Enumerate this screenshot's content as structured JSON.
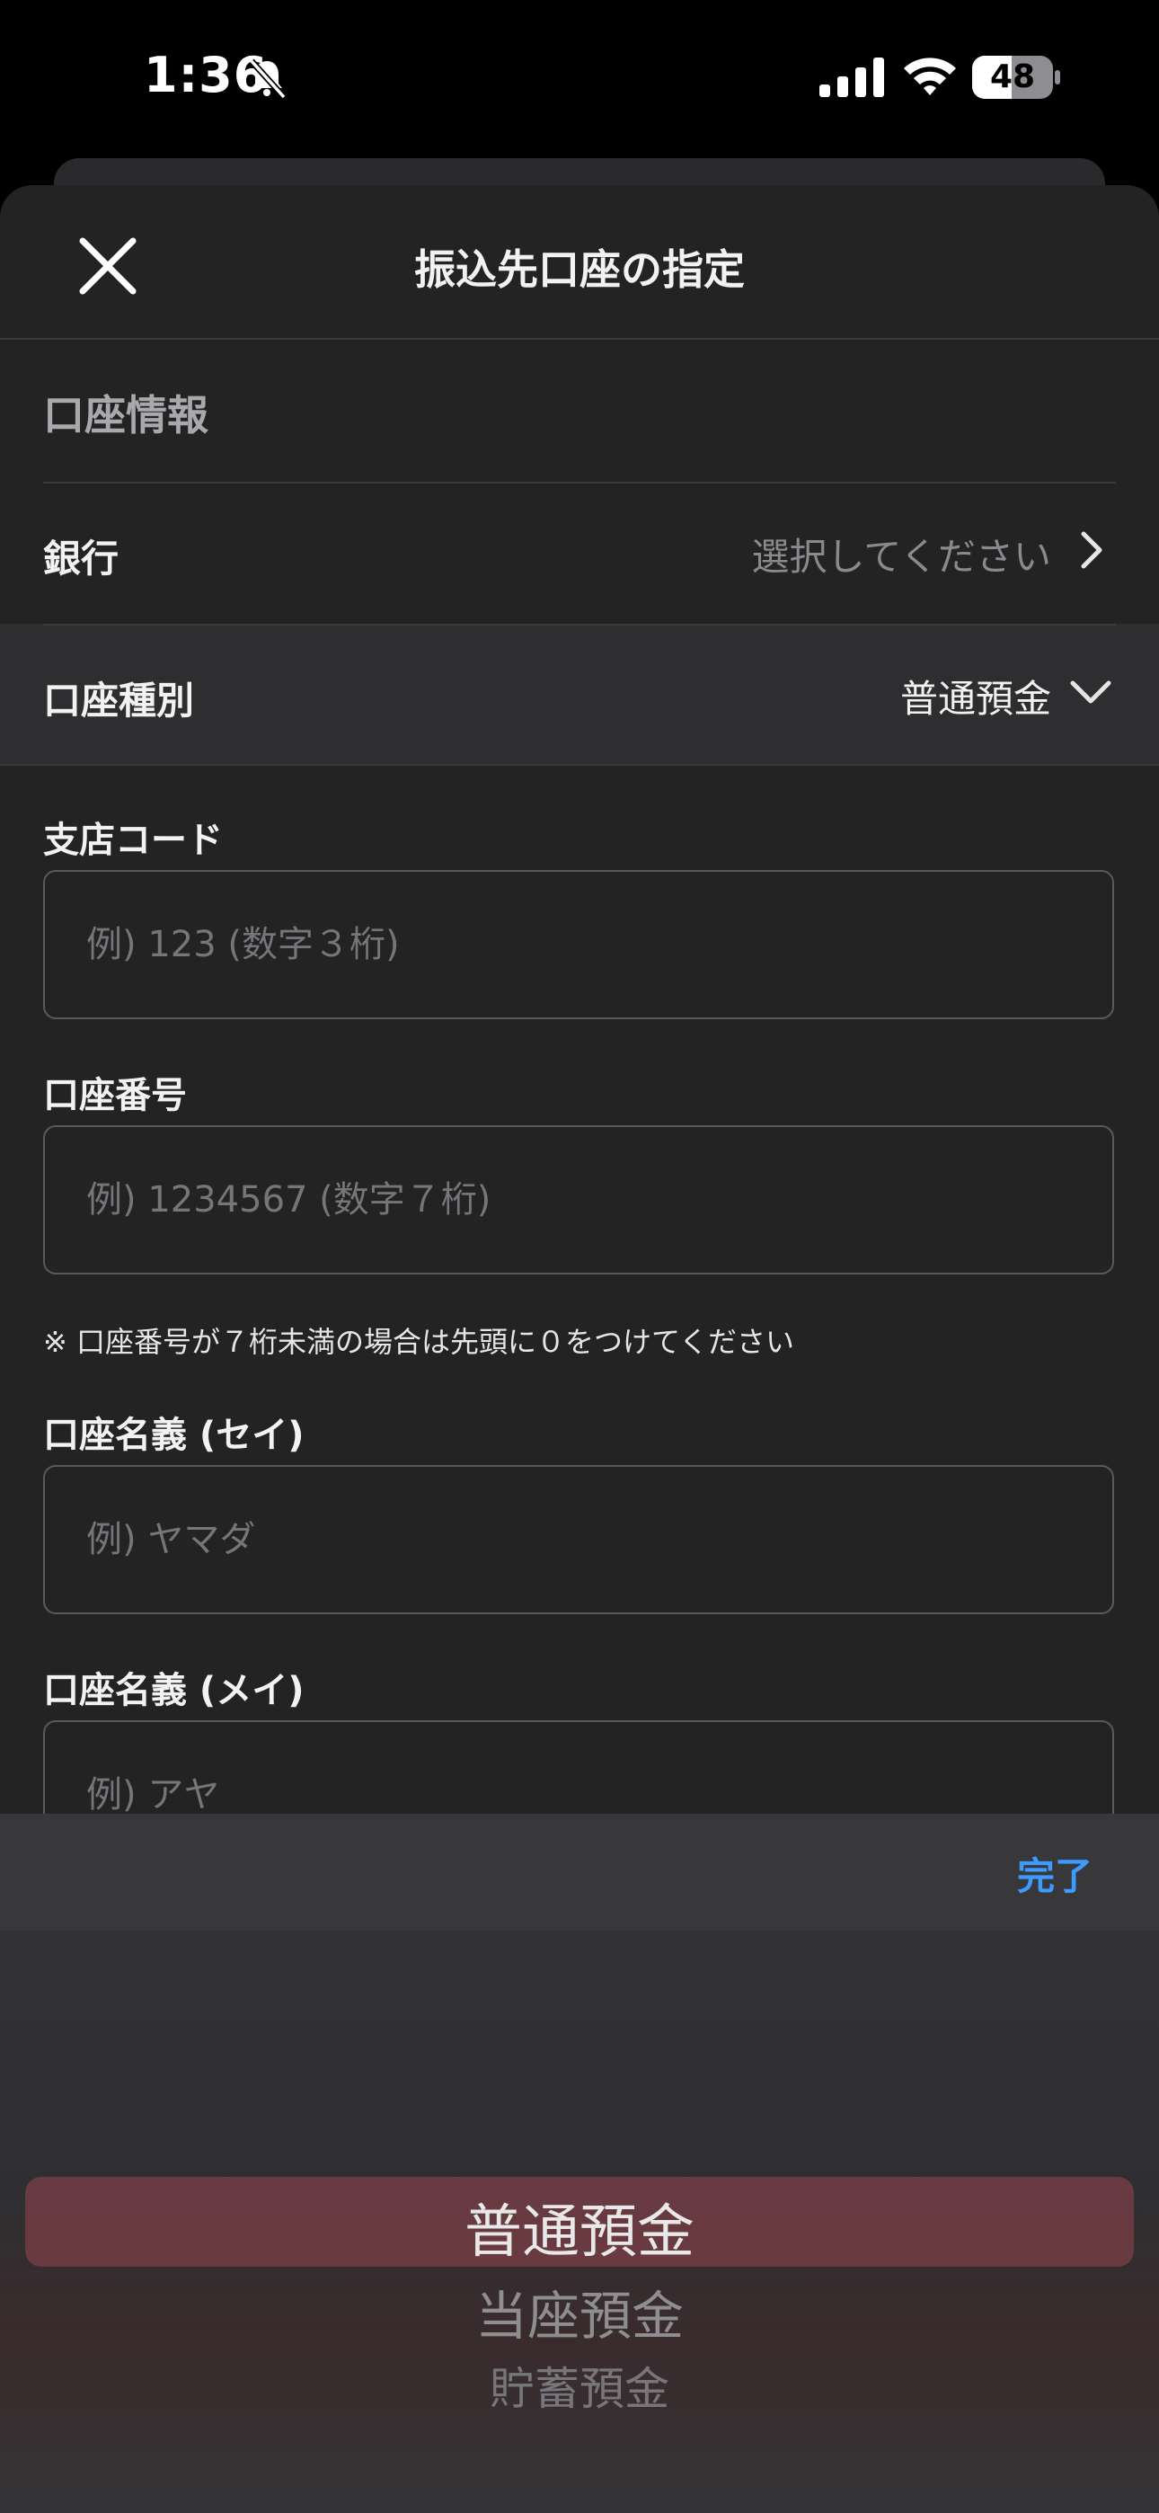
{
  "status_bar": {
    "time": "1:36",
    "battery": "48"
  },
  "header": {
    "title": "振込先口座の指定"
  },
  "section": {
    "title": "口座情報"
  },
  "bank_row": {
    "label": "銀行",
    "value": "選択してください"
  },
  "account_type_row": {
    "label": "口座種別",
    "value": "普通預金"
  },
  "fields": {
    "branch": {
      "label": "支店コード",
      "placeholder": "例) 123 (数字３桁)"
    },
    "account_number": {
      "label": "口座番号",
      "placeholder": "例) 1234567 (数字７桁)"
    },
    "name_sei": {
      "label": "口座名義 (セイ)",
      "placeholder": "例) ヤマダ"
    },
    "name_mei": {
      "label": "口座名義 (メイ)",
      "placeholder": "例) アヤ"
    }
  },
  "note": "※ 口座番号が７桁未満の場合は先頭に０をつけてください",
  "picker": {
    "done_label": "完了",
    "options": [
      "普通預金",
      "当座預金",
      "貯蓄預金"
    ],
    "selected": "普通預金"
  },
  "colors": {
    "accent": "#3d9bff",
    "sheet_bg": "#232324"
  }
}
